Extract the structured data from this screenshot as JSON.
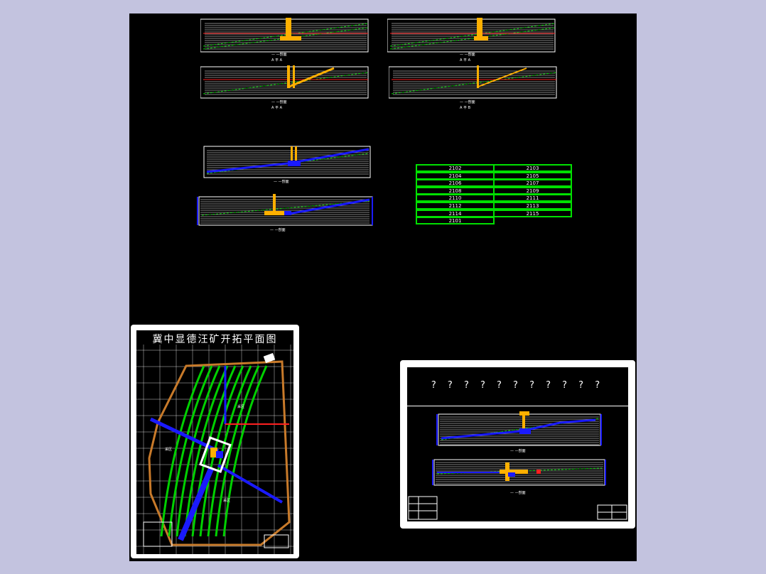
{
  "background_color": "#c3c3df",
  "canvas_color": "#000000",
  "colors": {
    "seam": "#00d000",
    "roadway": "#1a1aff",
    "shaft": "#ffb000",
    "strata": "#ffffff",
    "boundary": "#ff2020",
    "table_border": "#00e000"
  },
  "sections": {
    "top_left_a": {
      "caption": "— —剖面",
      "sub": "A  平  A"
    },
    "top_right_a": {
      "caption": "— —剖面",
      "sub": "A  平  A"
    },
    "top_left_b": {
      "caption": "— —剖面",
      "sub": "A  平  A"
    },
    "top_right_b": {
      "caption": "— —剖面",
      "sub": "A  平  B"
    },
    "mid_1": {
      "caption": "— —剖面"
    },
    "mid_2": {
      "caption": "— —剖面"
    }
  },
  "panel_table": {
    "left_column": [
      "2102",
      "2104",
      "2106",
      "2108",
      "2110",
      "2112",
      "2114",
      "2101"
    ],
    "right_column": [
      "2103",
      "2105",
      "2107",
      "2109",
      "2111",
      "2113",
      "2115"
    ]
  },
  "plan_sheet": {
    "title": "冀中显德汪矿开拓平面图",
    "area_labels": [
      "采区",
      "采区",
      "采区"
    ]
  },
  "section_sheet": {
    "title": "? ? ? ? ? ? ? ? ? ? ?",
    "captions": [
      "— —剖面",
      "— —剖面"
    ]
  }
}
